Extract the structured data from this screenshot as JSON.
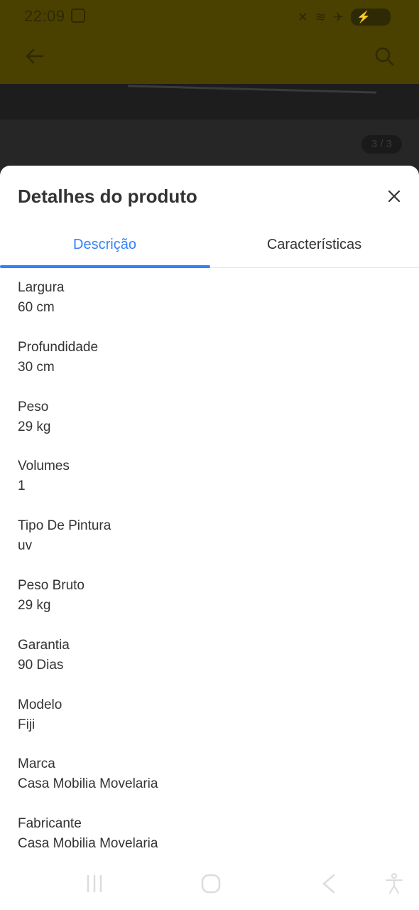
{
  "status_bar": {
    "time": "22:09",
    "battery": "48"
  },
  "photo": {
    "counter": "3 / 3"
  },
  "sheet": {
    "title": "Detalhes do produto",
    "tabs": [
      {
        "label": "Descrição",
        "active": true
      },
      {
        "label": "Características",
        "active": false
      }
    ],
    "specs": [
      {
        "label": "Largura",
        "value": "60 cm"
      },
      {
        "label": "Profundidade",
        "value": "30 cm"
      },
      {
        "label": "Peso",
        "value": "29 kg"
      },
      {
        "label": "Volumes",
        "value": "1"
      },
      {
        "label": "Tipo De Pintura",
        "value": "uv"
      },
      {
        "label": "Peso Bruto",
        "value": "29 kg"
      },
      {
        "label": "Garantia",
        "value": "90 Dias"
      },
      {
        "label": "Modelo",
        "value": "Fiji"
      },
      {
        "label": "Marca",
        "value": "Casa Mobilia Movelaria"
      },
      {
        "label": "Fabricante",
        "value": "Casa Mobilia Movelaria"
      }
    ]
  },
  "colors": {
    "accent": "#3483fa",
    "text": "#333333",
    "header_dimmed": "#4a4000"
  },
  "icons": {
    "back": "arrow-left-icon",
    "search": "search-icon",
    "close": "close-icon",
    "nav_recents": "recents-icon",
    "nav_home": "home-icon",
    "nav_back": "nav-back-icon",
    "nav_accessibility": "accessibility-icon"
  }
}
